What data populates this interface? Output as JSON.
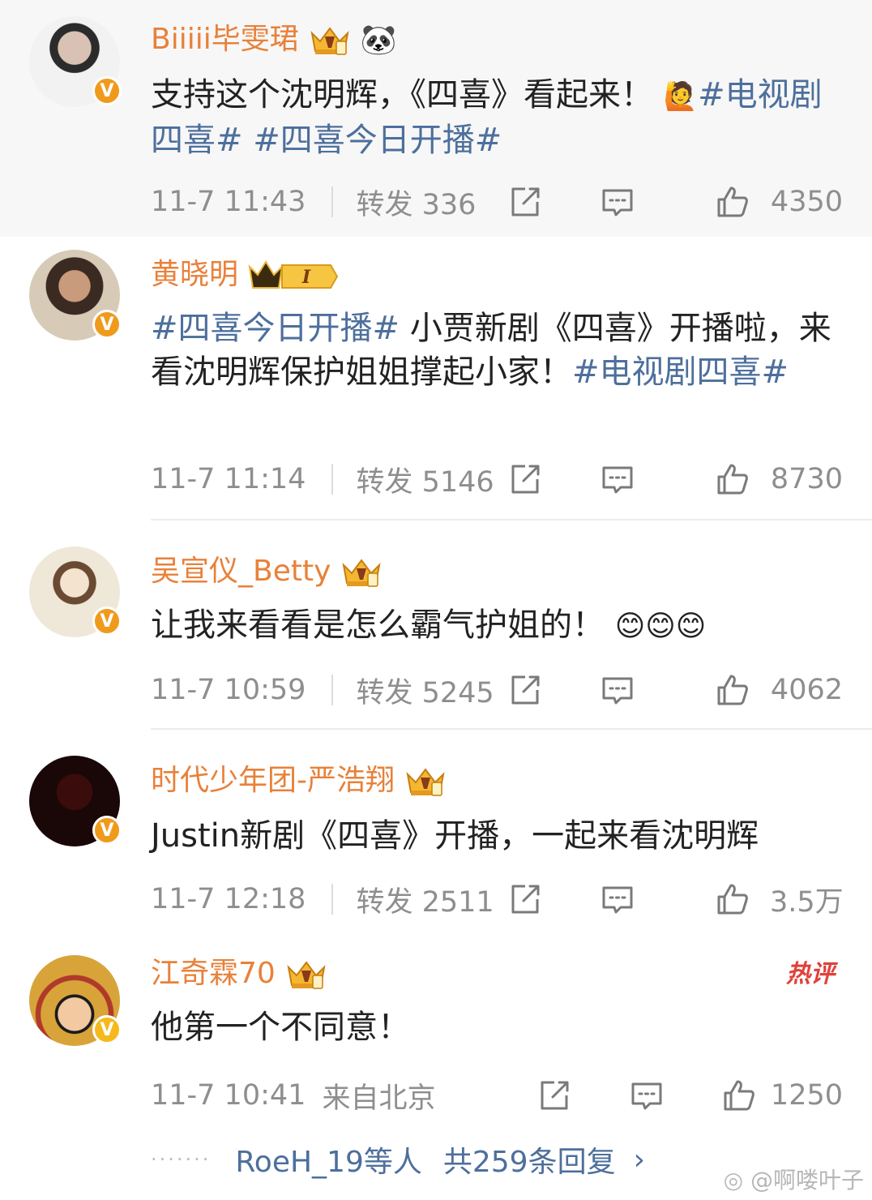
{
  "comments": [
    {
      "username": "Biiiii毕雯珺",
      "text_plain": "支持这个沈明辉，《四喜》看起来！",
      "emoji": "🙋",
      "tags": [
        "#电视剧四喜#",
        "#四喜今日开播#"
      ],
      "time": "11-7 11:43",
      "repost": "转发 336",
      "likes": "4350",
      "badge_icons": [
        "crown-badge-icon",
        "panda-icon"
      ]
    },
    {
      "username": "黄晓明",
      "tag_lead": "#四喜今日开播#",
      "text_plain": " 小贾新剧《四喜》开播啦，来看沈明辉保护姐姐撑起小家！",
      "tag_end": "#电视剧四喜#",
      "time": "11-7 11:14",
      "repost": "转发 5146",
      "likes": "8730",
      "level": "I"
    },
    {
      "username": "吴宣仪_Betty",
      "text_plain": "让我来看看是怎么霸气护姐的！",
      "emoji": "😊😊😊",
      "time": "11-7 10:59",
      "repost": "转发 5245",
      "likes": "4062"
    },
    {
      "username": "时代少年团-严浩翔",
      "text_plain": "Justin新剧《四喜》开播，一起来看沈明辉",
      "time": "11-7 12:18",
      "repost": "转发 2511",
      "likes": "3.5万"
    },
    {
      "username": "江奇霖70",
      "text_plain": "他第一个不同意！",
      "time": "11-7 10:41",
      "location": "来自北京",
      "likes": "1250",
      "hot_label": "热评"
    }
  ],
  "replies": {
    "dots": "·······",
    "who": "RoeH_19等人",
    "count": "共259条回复",
    "arrow": "›"
  },
  "watermark": "@啊喽叶子",
  "colors": {
    "username": "#e8813a",
    "hashtag": "#4d6f9c",
    "meta": "#8e8e8e",
    "hot": "#e0413a"
  }
}
